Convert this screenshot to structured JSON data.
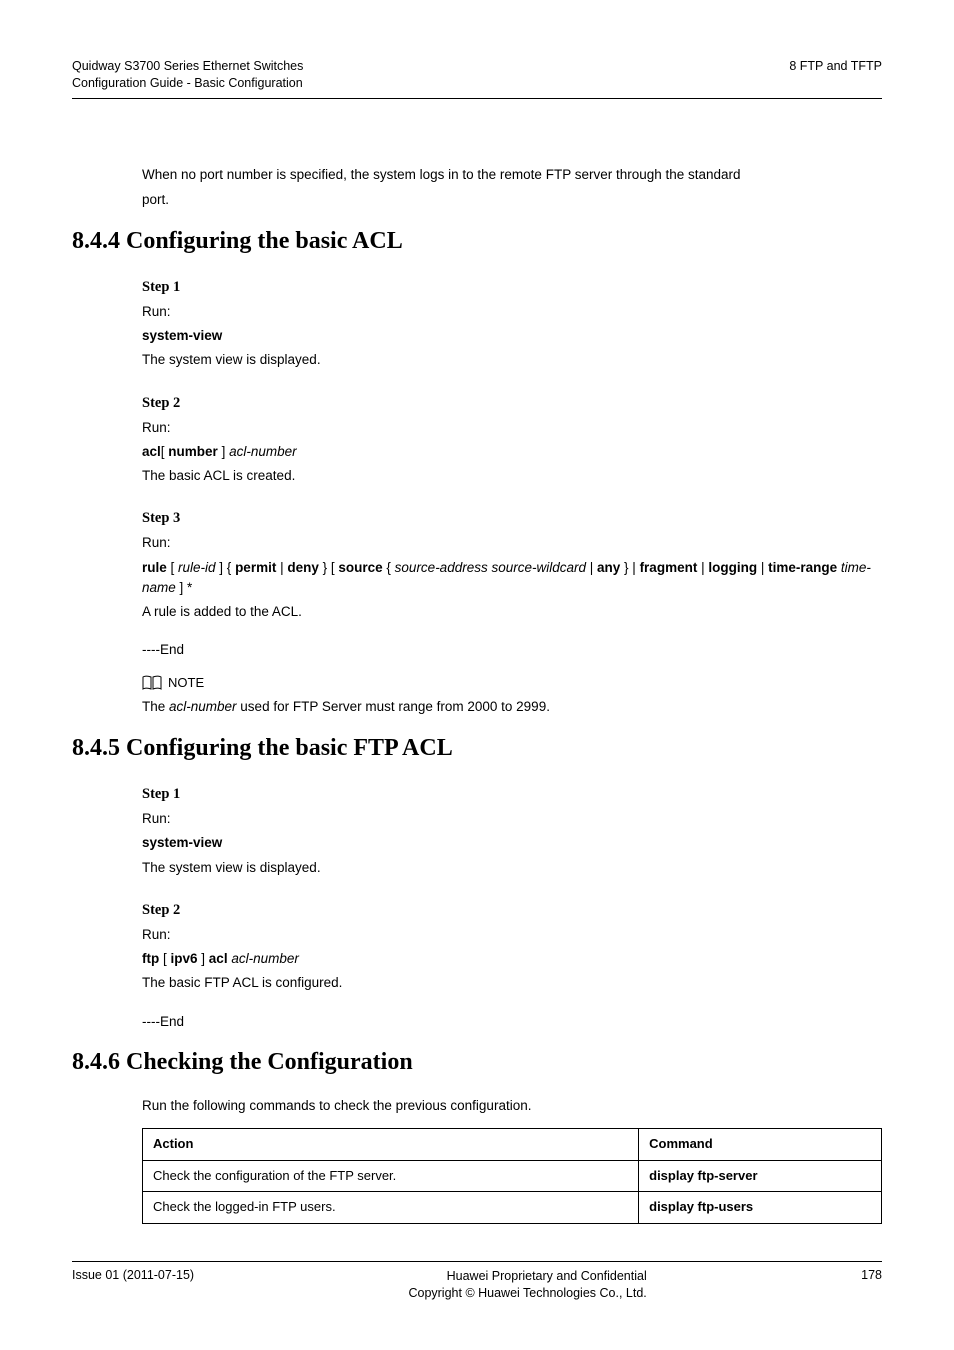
{
  "header": {
    "left_line1": "Quidway S3700 Series Ethernet Switches",
    "left_line2": "Configuration Guide - Basic Configuration",
    "right": "8 FTP and TFTP"
  },
  "intro": {
    "line1": "When no port number is specified, the system logs in to the remote FTP server through the standard",
    "line2": "port."
  },
  "section_844": {
    "heading": "8.4.4 Configuring the basic ACL",
    "step1_label": "Step 1",
    "step1_run": "Run:",
    "step1_cmd": "system-view",
    "step1_desc": "The system view is displayed.",
    "step2_label": "Step 2",
    "step2_run": "Run:",
    "step2_cmd": "acl",
    "step2_opt1": "[ ",
    "step2_opt_number": "number",
    "step2_opt2": " ] ",
    "step2_arg": "acl-number",
    "step2_desc": "The basic ACL is created.",
    "step3_label": "Step 3",
    "step3_run": "Run:",
    "step3_cmd": "rule ",
    "step3_seg_open1": "[ ",
    "step3_ruleid": "rule-id",
    "step3_seg_close1": " ] { ",
    "step3_permit": "permit",
    "step3_pipe1": " | ",
    "step3_deny": "deny",
    "step3_seg_close2": " } [ ",
    "step3_source": "source",
    "step3_seg_open2": " { ",
    "step3_srcaddr": "source-address source-wildcard",
    "step3_pipe2": " | ",
    "step3_any": "any",
    "step3_seg_close3": " } | ",
    "step3_fragment": "fragment",
    "step3_pipe3": " | ",
    "step3_logging": "logging",
    "step3_pipe4": " | ",
    "step3_timerange": "time-range",
    "step3_space": " ",
    "step3_timearg": "time-name",
    "step3_tail": " ] *",
    "step3_desc": "A rule is added to the ACL.",
    "end": "----End",
    "note_label": "NOTE",
    "note_text_prefix": "The ",
    "note_text_arg": "acl-number",
    "note_text_suffix": " used for FTP Server must range from 2000 to 2999."
  },
  "section_845": {
    "heading": "8.4.5 Configuring the basic FTP ACL",
    "step1_label": "Step 1",
    "step1_run": "Run:",
    "step1_cmd": "system-view",
    "step1_desc": "The system view is displayed.",
    "step2_label": "Step 2",
    "step2_run": "Run:",
    "step2_cmd1": "ftp",
    "step2_opt_open": " [ ",
    "step2_ipv6": "ipv6",
    "step2_opt_close": " ] ",
    "step2_cmd2": "acl",
    "step2_space": " ",
    "step2_arg": "acl-number",
    "step2_desc": "The basic FTP ACL is configured.",
    "end": "----End"
  },
  "section_846": {
    "heading": "8.4.6 Checking the Configuration",
    "intro": "Run the following commands to check the previous configuration.",
    "table": {
      "h1": "Action",
      "h2": "Command",
      "r1c1": "Check the configuration of the FTP server.",
      "r1c2_cmd": "display ftp-server",
      "r2c1": "Check the logged-in FTP users.",
      "r2c2_cmd": "display ftp-users"
    }
  },
  "footer": {
    "left_line1": "Issue 01 (2011-07-15)",
    "right_line1": "Huawei Proprietary and Confidential",
    "right_line2": "Copyright © Huawei Technologies Co., Ltd.",
    "page": "178"
  }
}
